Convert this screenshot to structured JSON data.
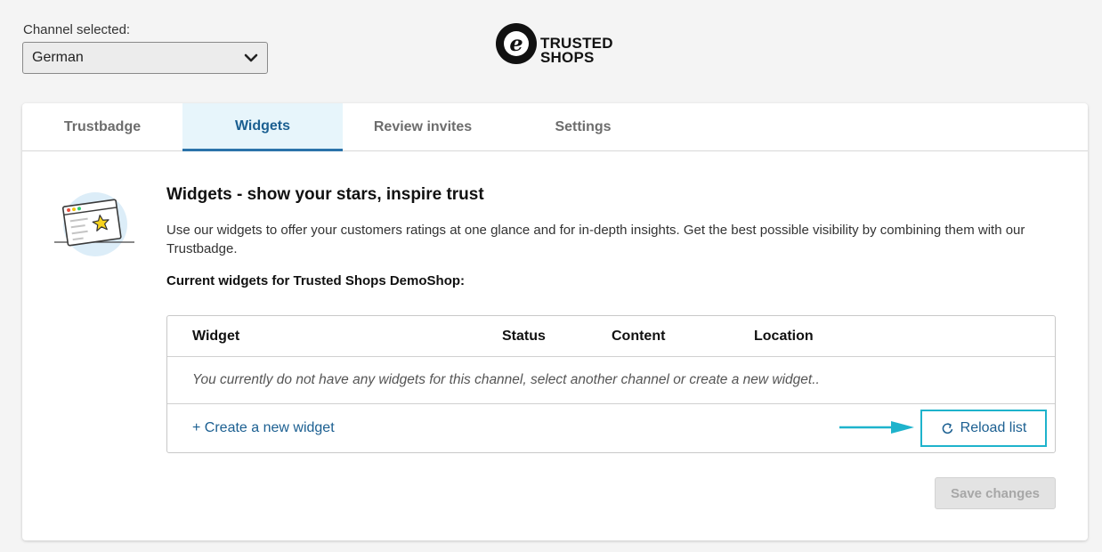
{
  "channel": {
    "label": "Channel selected:",
    "selected": "German"
  },
  "logo": {
    "glyph": "e",
    "line1": "TRUSTED",
    "line2": "SHOPS"
  },
  "tabs": [
    {
      "label": "Trustbadge",
      "active": false
    },
    {
      "label": "Widgets",
      "active": true
    },
    {
      "label": "Review invites",
      "active": false
    },
    {
      "label": "Settings",
      "active": false
    }
  ],
  "widgets": {
    "heading": "Widgets - show your stars, inspire trust",
    "description": "Use our widgets to offer your customers ratings at one glance and for in-depth insights. Get the best possible visibility by combining them with our Trustbadge.",
    "current_label": "Current widgets for Trusted Shops DemoShop:",
    "table": {
      "columns": [
        "Widget",
        "Status",
        "Content",
        "Location"
      ],
      "empty_message": "You currently do not have any widgets for this channel, select another channel or create a new widget..",
      "create_link": "+ Create a new widget",
      "reload_label": "Reload list"
    },
    "save_label": "Save changes"
  },
  "colors": {
    "accent": "#1b5f91",
    "highlight": "#1eb3cc",
    "active_tab_bg": "#e7f5fb"
  },
  "icons": {
    "select": "chevron-down-icon",
    "reload": "reload-icon",
    "illustration": "browser-star-illustration",
    "annotation": "arrow-right-icon"
  }
}
